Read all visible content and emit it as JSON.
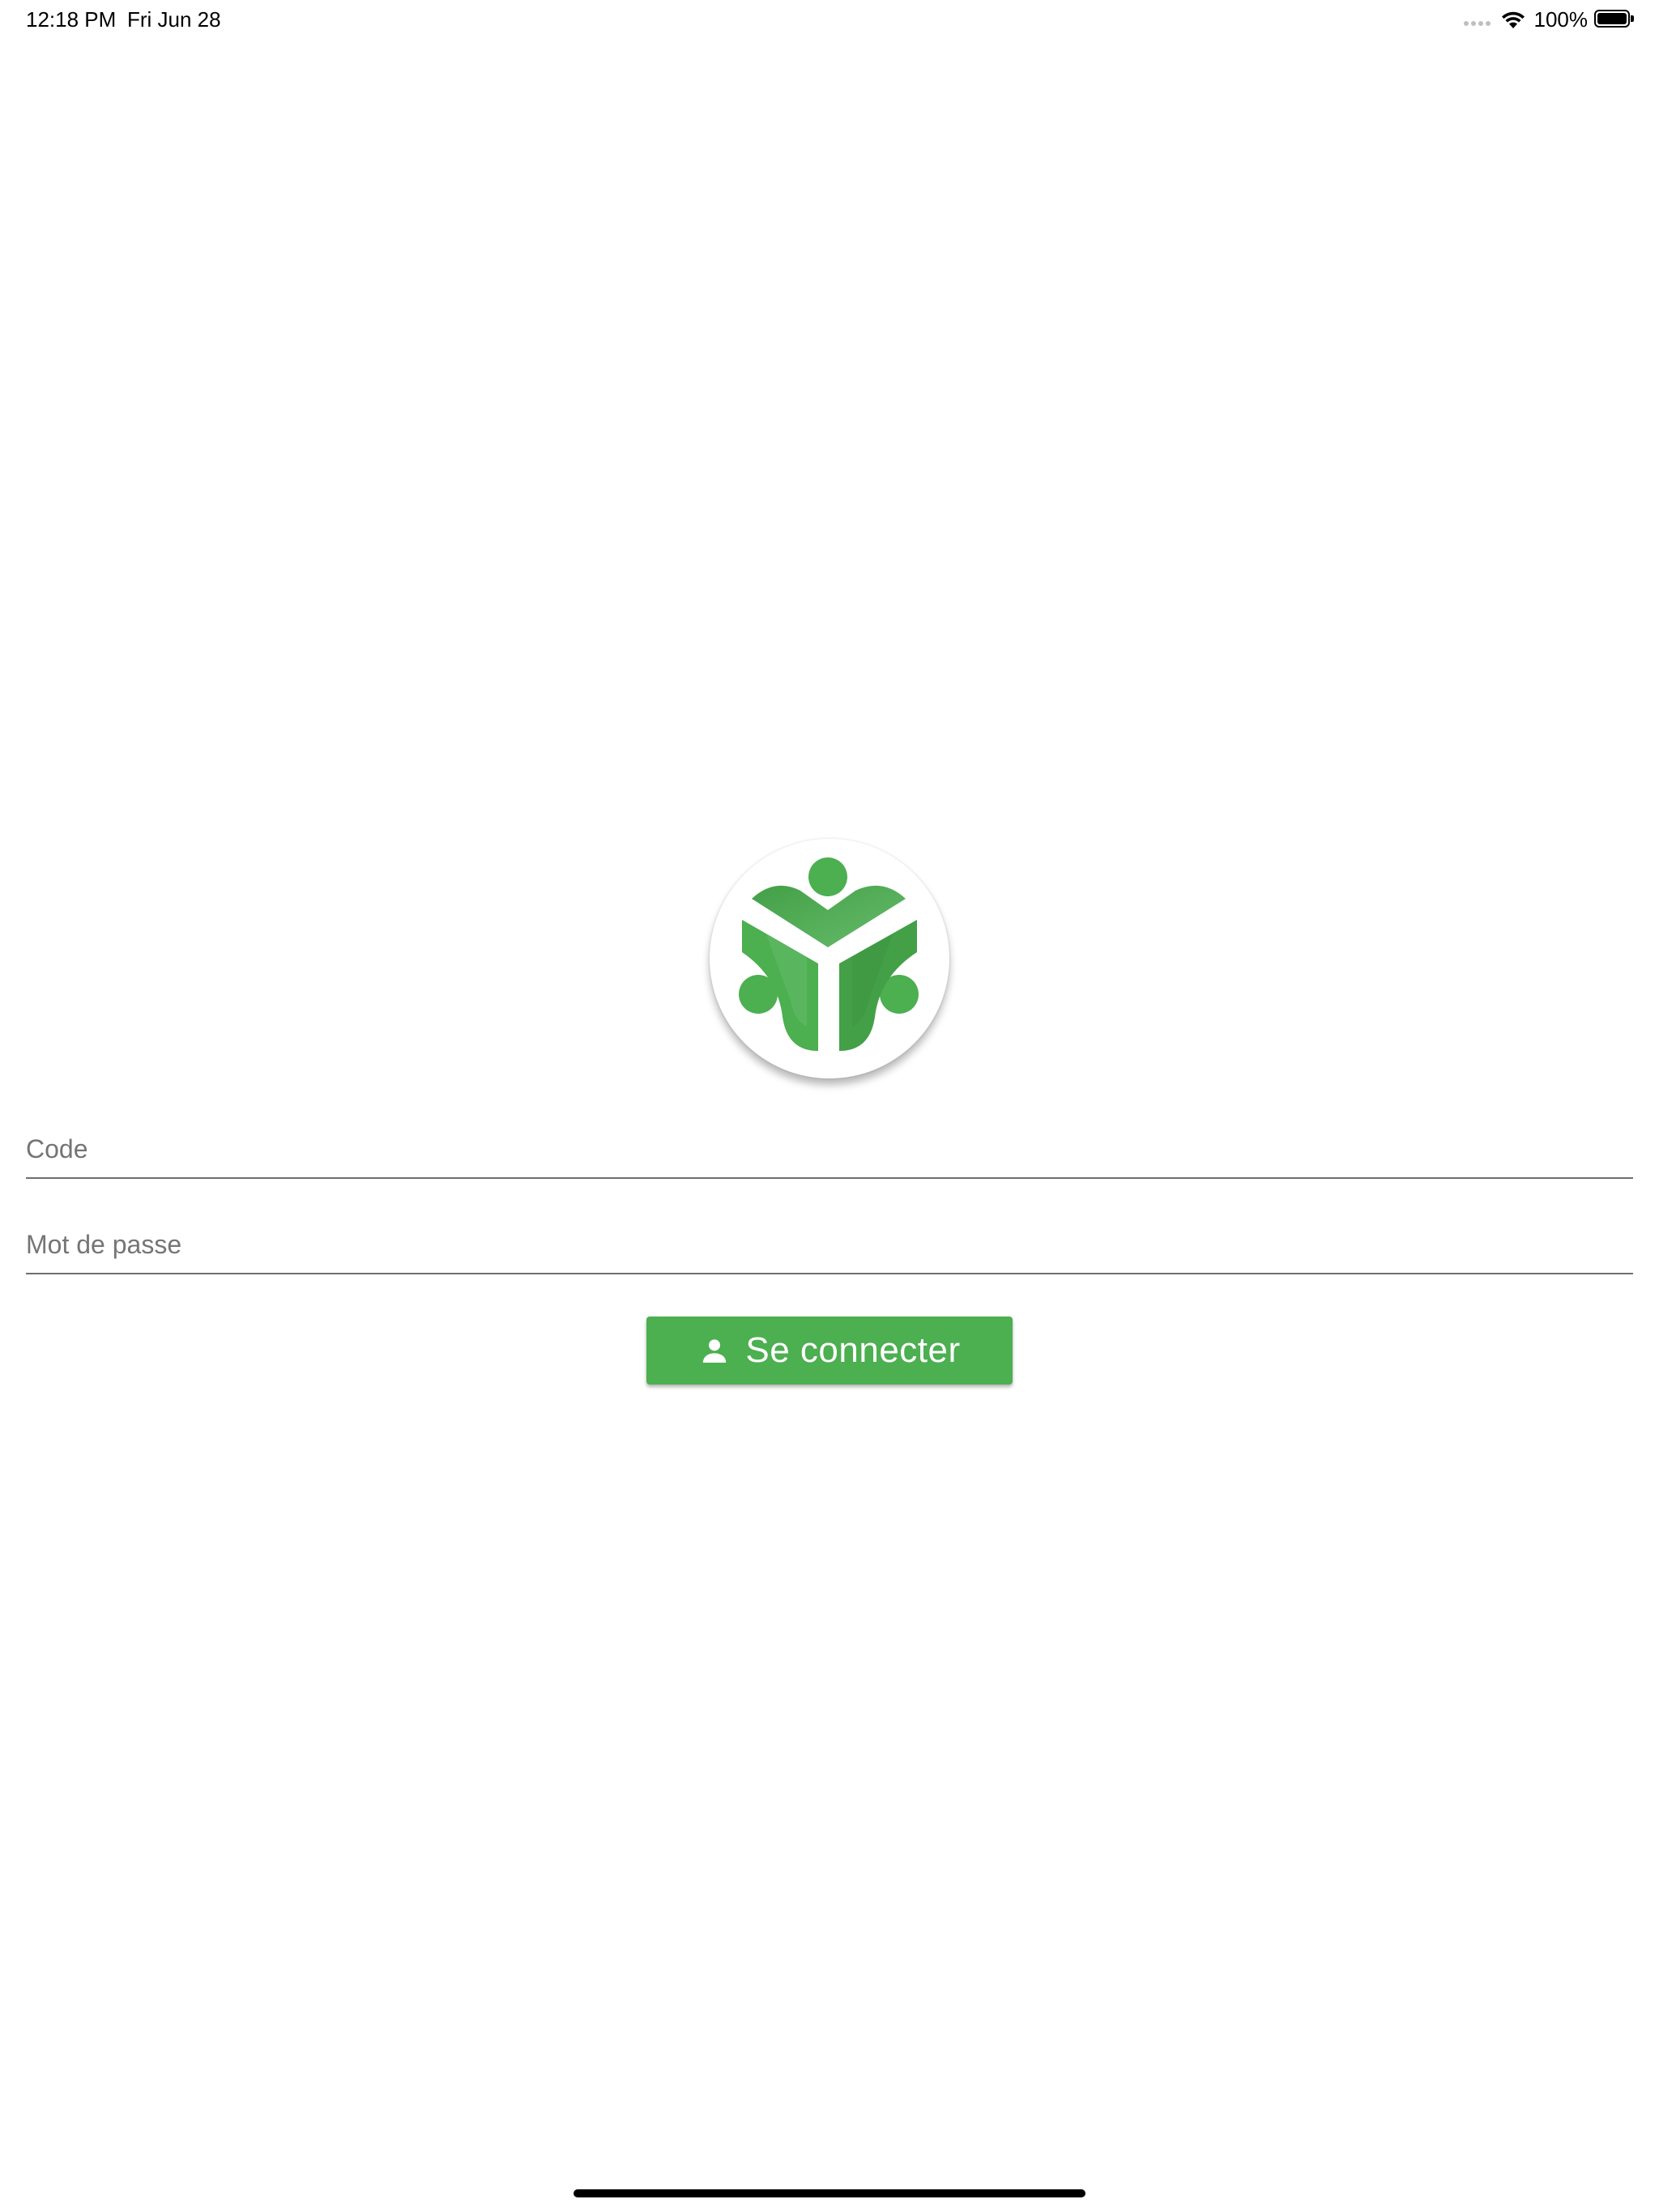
{
  "status_bar": {
    "time": "12:18 PM",
    "date": "Fri Jun 28",
    "battery_percent": "100%",
    "battery_level": 1.0,
    "icons": [
      "signal-dots-icon",
      "wifi-icon",
      "battery-icon"
    ]
  },
  "logo": {
    "icon": "people-logo-icon",
    "colors": {
      "primary": "#4caf50",
      "dark": "#388e3c"
    }
  },
  "login_form": {
    "code_placeholder": "Code",
    "code_value": "",
    "password_placeholder": "Mot de passe",
    "password_value": "",
    "submit_label": "Se connecter",
    "submit_icon": "person-icon"
  },
  "colors": {
    "accent": "#4caf50",
    "input_underline": "#6f6f6f",
    "placeholder": "#757575"
  }
}
